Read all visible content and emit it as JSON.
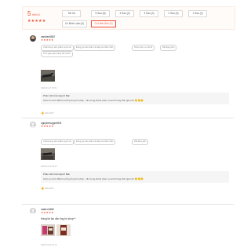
{
  "summary": {
    "rating": "5",
    "rating_suffix": "trên 5",
    "stars": "★★★★★",
    "filters": [
      "Tất Cả",
      "5 Sao (8)",
      "4 Sao (0)",
      "3 Sao (0)",
      "2 Sao (0)",
      "1 Sao (0)",
      "Có Bình Luận (2)",
      "Có Hình Ảnh (2)"
    ],
    "active_filter": "Có Hình Ảnh (2)"
  },
  "reviews": [
    {
      "username": "vanhien5867",
      "stars": "★★★★★",
      "chips": [
        "Chất lượng sản phẩm tuyệt vời",
        "Đóng gói sản phẩm rất đẹp và chắc chắn",
        "Shop phục vụ rất tốt",
        "Rất đáng tiền",
        "Thời gian giao hàng rất nhanh"
      ],
      "timestamp": "2020-04-17 15:51",
      "reply_title": "Phản Hồi Của Người Bán",
      "reply_text": "Cảm ơn anh /đã tin tưởng ủng hộ shop , rất mong được phục vụ anh trong thời gian tới 🙂🙂🙂",
      "helpful": "Hữu Ích?"
    },
    {
      "username": "nguyenhuygmt003",
      "stars": "★★★★★",
      "chips": [
        "Chất lượng sản phẩm tuyệt vời",
        "Đóng gói sản phẩm rất đẹp và chắc chắn",
        "Rất đáng tiền"
      ],
      "timestamp": "2020-04-16 18:43",
      "reply_title": "Phản Hồi Của Người Bán",
      "reply_text": "Cảm ơn anh /đã tin tưởng ủng hộ shop , rất mong được phục vụ anh trong thời gian tới 🙂🙂🙂",
      "helpful": "Hữu Ích?"
    },
    {
      "username": "matien1686",
      "stars": "★★★★★",
      "comment": "Hàng tốt lần sẵn ủng hộ shop^^",
      "timestamp": "2020-04-09 15:13",
      "helpful": "Hữu Ích?"
    }
  ],
  "colors": {
    "accent": "#ee4d2d",
    "summary_bg": "#fffbf8",
    "reply_bg": "#f5f5f5"
  }
}
